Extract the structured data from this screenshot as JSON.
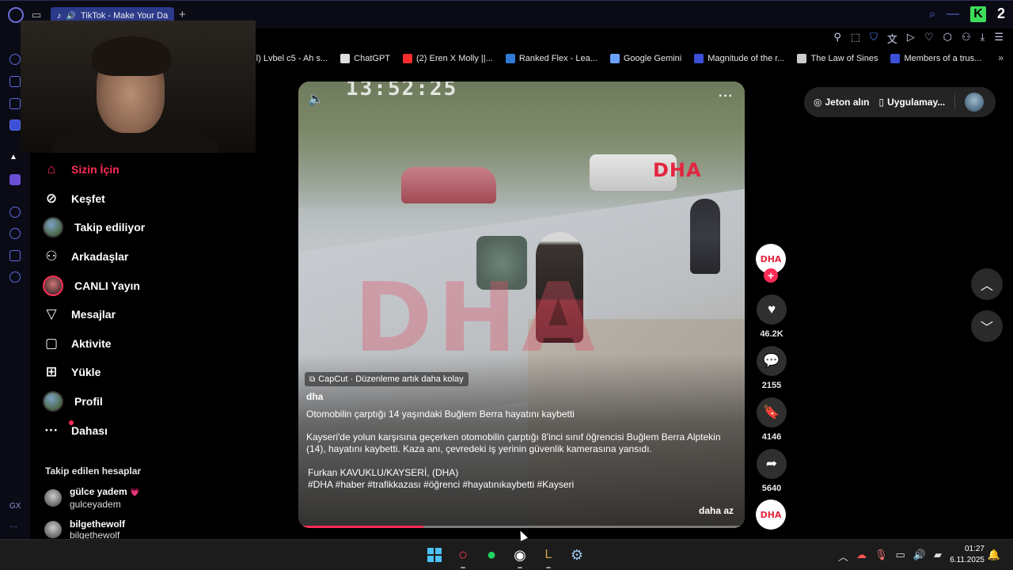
{
  "browser": {
    "tab_title": "TikTok - Make Your Da",
    "badge_number": "2"
  },
  "bookmarks": [
    {
      "label": "(l) Lvbel c5 - Ah s...",
      "icon_color": "#888888"
    },
    {
      "label": "ChatGPT",
      "icon_color": "#dddddd"
    },
    {
      "label": "(2) Eren X Molly ||...",
      "icon_color": "#ff2d2d"
    },
    {
      "label": "Ranked Flex - Lea...",
      "icon_color": "#2f7bd6"
    },
    {
      "label": "Google Gemini",
      "icon_color": "#6aa0ff"
    },
    {
      "label": "Magnitude of the r...",
      "icon_color": "#3b4fd8"
    },
    {
      "label": "The Law of Sines",
      "icon_color": "#cccccc"
    },
    {
      "label": "Members of a trus...",
      "icon_color": "#3b4fd8"
    }
  ],
  "sidebar": {
    "items": [
      {
        "label": "Sizin İçin",
        "icon": "home-icon",
        "active": true
      },
      {
        "label": "Keşfet",
        "icon": "compass-icon"
      },
      {
        "label": "Takip ediliyor",
        "icon": "avatar"
      },
      {
        "label": "Arkadaşlar",
        "icon": "friends-icon"
      },
      {
        "label": "CANLI Yayın",
        "icon": "live-avatar"
      },
      {
        "label": "Mesajlar",
        "icon": "send-icon"
      },
      {
        "label": "Aktivite",
        "icon": "activity-icon"
      },
      {
        "label": "Yükle",
        "icon": "upload-icon"
      },
      {
        "label": "Profil",
        "icon": "profile-avatar"
      },
      {
        "label": "Dahası",
        "icon": "more-icon"
      }
    ],
    "following_title": "Takip edilen hesaplar",
    "following": [
      {
        "name": "gülce yadem",
        "handle": "gulceyadem"
      },
      {
        "name": "bilgethewolf",
        "handle": "bilgethewolf"
      }
    ]
  },
  "video": {
    "timestamp_overlay": "13:52:25",
    "channel_logo": "DHA",
    "watermark": "DHA",
    "capcut_label": "CapCut · Düzenleme artık daha kolay",
    "author": "dha",
    "caption_title": "Otomobilin çarptığı 14 yaşındaki Buğlem Berra hayatını kaybetti",
    "caption_body": "Kayseri'de yolun karşısına geçerken otomobilin çarptığı 8'inci sınıf öğrencisi Buğlem Berra Alptekin (14), hayatını kaybetti. Kaza anı, çevredeki iş yerinin güvenlik kamerasına yansıdı.",
    "caption_credit": "Furkan KAVUKLU/KAYSERİ, (DHA)",
    "hashtags": "#DHA #haber #trafikkazası #öğrenci #hayatınıkaybetti #Kayseri",
    "less_label": "daha az",
    "progress": 0.28
  },
  "actions": {
    "avatar_label": "DHA",
    "likes": "46.2K",
    "comments": "2155",
    "saves": "4146",
    "shares": "5640"
  },
  "top_pill": {
    "coins_label": "Jeton alın",
    "app_label": "Uygulamay..."
  },
  "taskbar": {
    "time": "01:27",
    "date": "6.11.2025"
  }
}
